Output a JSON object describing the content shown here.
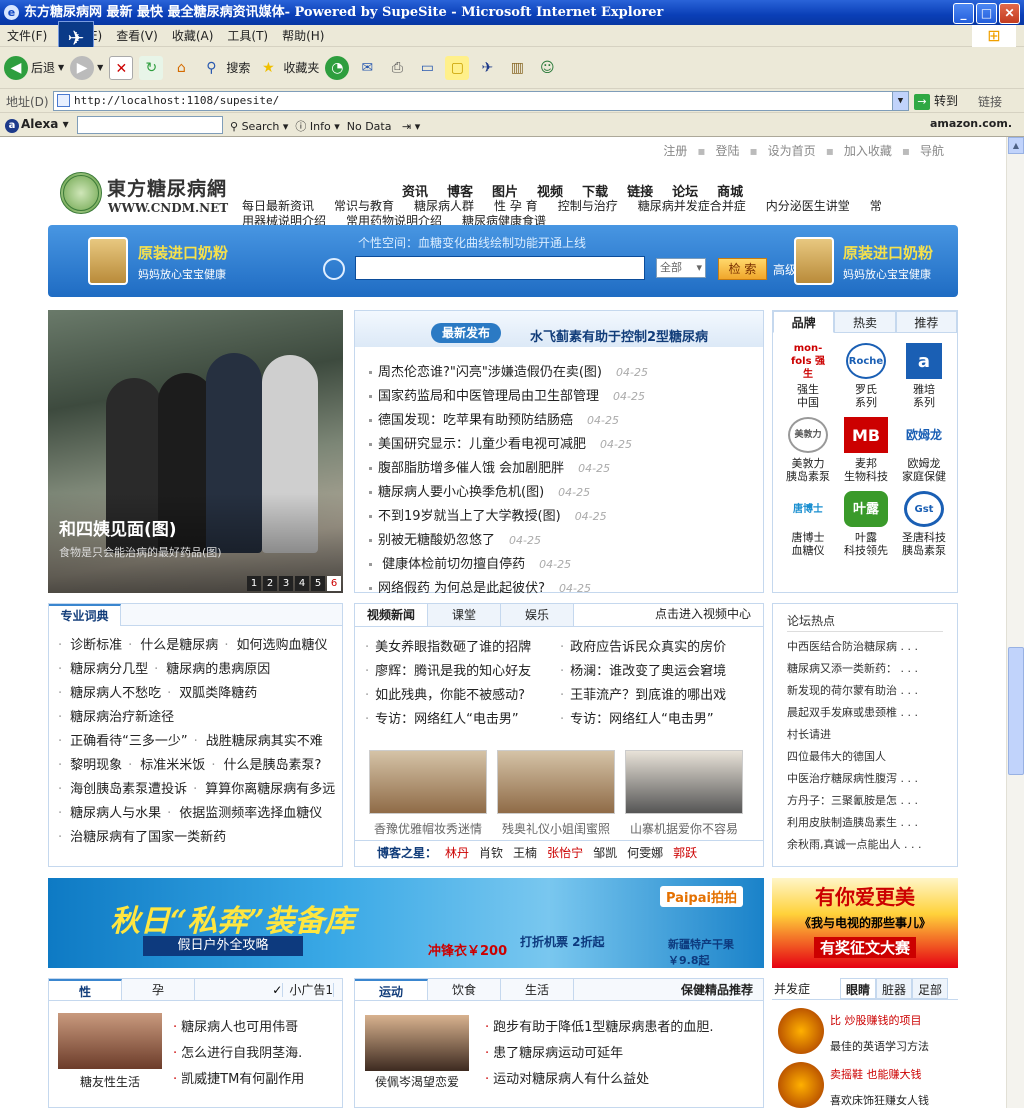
{
  "window": {
    "title": "东方糖尿病网  最新 最快 最全糖尿病资讯媒体- Powered by SupeSite - Microsoft Internet Explorer",
    "min": "_",
    "max": "□",
    "close": "✕"
  },
  "menu": [
    "文件(F)",
    "编辑(E)",
    "查看(V)",
    "收藏(A)",
    "工具(T)",
    "帮助(H)"
  ],
  "toolbar": {
    "back": "后退",
    "search": "搜索",
    "favorites": "收藏夹"
  },
  "address": {
    "label": "地址(D)",
    "url": "http://localhost:1108/supesite/",
    "go": "转到",
    "links": "链接"
  },
  "alexa": {
    "brand": "Alexa",
    "search": "Search",
    "info": "Info",
    "nodata": "No Data",
    "amazon": "amazon.com."
  },
  "util": [
    "注册",
    "登陆",
    "设为首页",
    "加入收藏",
    "导航"
  ],
  "logo": {
    "cn": "東方糖尿病網",
    "url": "WWW.CNDM.NET"
  },
  "nav_main": [
    "资讯",
    "博客",
    "图片",
    "视频",
    "下载",
    "链接",
    "论坛",
    "商城"
  ],
  "nav_sub": [
    "每日最新资讯",
    "常识与教育",
    "糖尿病人群",
    "性 孕 育",
    "控制与治疗",
    "糖尿病并发症合并症",
    "内分泌医生讲堂",
    "常",
    "用器械说明介绍",
    "常用药物说明介绍",
    "糖尿病健康食谱"
  ],
  "banner": {
    "ad_title": "原装进口奶粉",
    "ad_sub": "妈妈放心宝宝健康",
    "note": "个性空间：血糖变化曲线绘制功能开通上线",
    "select": "全部",
    "search_btn": "检 索",
    "advanced": "高级搜索"
  },
  "photo": {
    "title": "和四姨见面(图)",
    "sub": "食物是只会能治病的最好药品(图)",
    "pages": [
      "1",
      "2",
      "3",
      "4",
      "5",
      "6"
    ]
  },
  "latest": {
    "tag": "最新发布",
    "headline": "水飞蓟素有助于控制2型糖尿病",
    "items": [
      {
        "t": "周杰伦恋谁?\"闪亮\"涉嫌造假仍在卖(图)",
        "d": "04-25"
      },
      {
        "t": "国家药监局和中医管理局由卫生部管理",
        "d": "04-25"
      },
      {
        "t": "德国发现：吃苹果有助预防结肠癌",
        "d": "04-25"
      },
      {
        "t": "美国研究显示：儿童少看电视可减肥",
        "d": "04-25"
      },
      {
        "t": "腹部脂肪增多催人饿 会加剧肥胖",
        "d": "04-25"
      },
      {
        "t": "糖尿病人要小心换季危机(图)",
        "d": "04-25"
      },
      {
        "t": "不到19岁就当上了大学教授(图)",
        "d": "04-25"
      },
      {
        "t": "别被无糖酸奶忽悠了",
        "d": "04-25"
      },
      {
        "t": " 健康体检前切勿擅自停药",
        "d": "04-25"
      },
      {
        "t": "网络假药 为何总是此起彼伏?",
        "d": "04-25"
      }
    ]
  },
  "brand": {
    "tabs": [
      "品牌",
      "热卖",
      "推荐"
    ],
    "items": [
      {
        "logo": "mon-fols 强生",
        "name": "强生\n中国"
      },
      {
        "logo": "Roche",
        "name": "罗氏\n系列"
      },
      {
        "logo": "a",
        "name": "雅培\n系列"
      },
      {
        "logo": "美敦力",
        "name": "美敦力\n胰岛素泵"
      },
      {
        "logo": "MB",
        "name": "麦邦\n生物科技"
      },
      {
        "logo": "欧姆龙",
        "name": "欧姆龙\n家庭保健"
      },
      {
        "logo": "唐博士",
        "name": "唐博士\n血糖仪"
      },
      {
        "logo": "叶露",
        "name": "叶露\n科技领先"
      },
      {
        "logo": "Gst",
        "name": "圣唐科技\n胰岛素泵"
      }
    ]
  },
  "dict": {
    "title": "专业词典",
    "items": [
      "诊断标准",
      "什么是糖尿病",
      "如何选购血糖仪",
      "糖尿病分几型",
      "糖尿病的患病原因",
      "糖尿病人不愁吃",
      "双胍类降糖药",
      "糖尿病治疗新途径",
      "正确看待“三多一少”",
      "战胜糖尿病其实不难",
      "黎明现象",
      "标准米米饭",
      "什么是胰岛素泵?",
      "海创胰岛素泵遭投诉",
      "算算你离糖尿病有多远",
      "糖尿病人与水果",
      "依据监测频率选择血糖仪",
      "治糖尿病有了国家一类新药"
    ]
  },
  "video": {
    "tabs": [
      "视频新闻",
      "课堂",
      "娱乐"
    ],
    "more": "点击进入视频中心",
    "items": [
      "美女养眼指数砸了谁的招牌",
      "政府应告诉民众真实的房价",
      "廖辉：腾讯是我的知心好友",
      "杨澜：谁改变了奥运会窘境",
      "如此残典，你能不被感动?",
      "王菲流产？到底谁的哪出戏",
      "专访：网络红人“电击男”",
      "专访：网络红人“电击男”"
    ],
    "thumbs": [
      "香豫优雅帽妆秀迷情",
      "残奥礼仪小姐闺蜜照",
      "山寨机据爱你不容易"
    ],
    "blogger_label": "博客之星：",
    "bloggers": [
      "林丹",
      "肖钦",
      "王楠",
      "张怡宁",
      "邹凯",
      "何雯娜",
      "郭跃"
    ]
  },
  "forum": {
    "title": "论坛热点",
    "items": [
      "中西医结合防治糖尿病 . . .",
      "糖尿病又添一类新药： . . .",
      "新发现的荷尔蒙有助治 . . .",
      "晨起双手发麻或患颈椎 . . .",
      "村长请进",
      "四位最伟大的德国人",
      "中医治疗糖尿病性腹泻 . . .",
      "方丹子：三聚氰胺是怎 . . .",
      "利用皮肤制造胰岛素生 . . .",
      "余秋雨,真诚一点能出人 . . ."
    ]
  },
  "ad_main": {
    "title": "秋日“私奔”装备库",
    "sub": "假日户外全攻略",
    "jacket": "冲锋衣￥200",
    "ticket": "打折机票 2折起",
    "pp": "Paipai拍拍",
    "fruit": "新疆特产干果 ￥9.8起"
  },
  "ad_side": {
    "a": "有你爱更美",
    "b": "《我与电视的那些事儿》",
    "c": "有奖征文大赛"
  },
  "sex": {
    "tabs": [
      "性",
      "孕"
    ],
    "ad": "小广告1",
    "caption": "糖友性生活",
    "items": [
      "糖尿病人也可用伟哥",
      "怎么进行自我阴茎海.",
      "凯威捷TM有何副作用"
    ]
  },
  "sport": {
    "tabs": [
      "运动",
      "饮食",
      "生活"
    ],
    "right": "保健精品推荐",
    "caption": "侯佩岑渴望恋爱",
    "items": [
      "跑步有助于降低1型糖尿病患者的血胆.",
      "患了糖尿病运动可延年",
      "运动对糖尿病人有什么益处"
    ]
  },
  "comp": {
    "label": "并发症",
    "tabs": [
      "眼睛",
      "脏器",
      "足部"
    ],
    "items": [
      "比  炒股赚钱的项目",
      "最佳的英语学习方法",
      "卖摇鞋  也能赚大钱",
      "喜欢床饰狂赚女人钱"
    ]
  }
}
